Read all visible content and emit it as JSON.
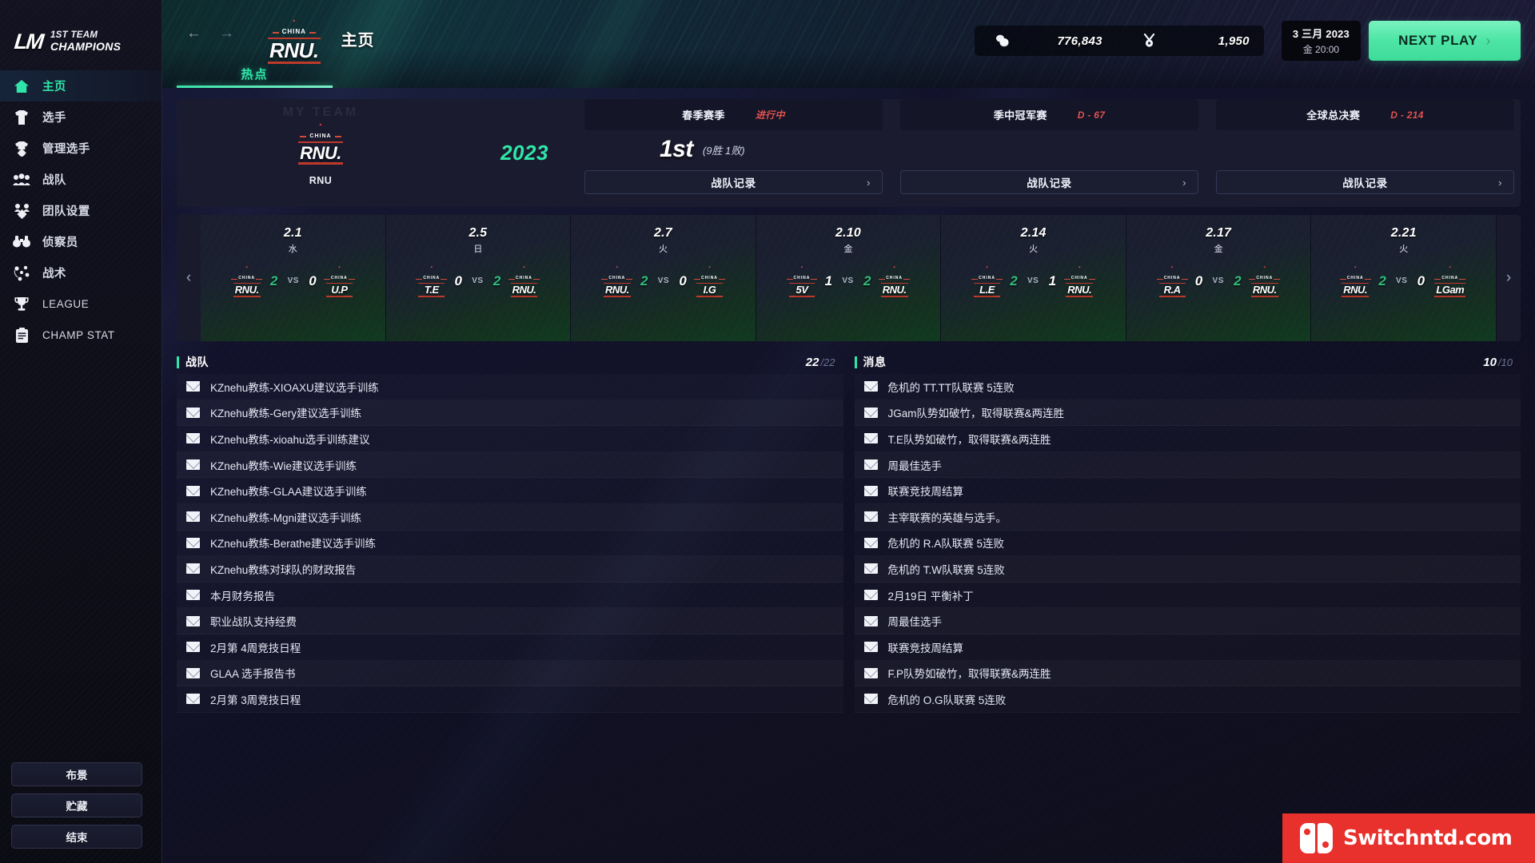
{
  "brand": {
    "mark": "LM",
    "line1": "1ST TEAM",
    "line2": "CHAMPIONS"
  },
  "sidebar": {
    "items": [
      {
        "label": "主页",
        "icon": "home-icon",
        "active": true
      },
      {
        "label": "选手",
        "icon": "jersey-icon",
        "active": false
      },
      {
        "label": "管理选手",
        "icon": "jersey-gear-icon",
        "active": false
      },
      {
        "label": "战队",
        "icon": "people-icon",
        "active": false
      },
      {
        "label": "团队设置",
        "icon": "people-gear-icon",
        "active": false
      },
      {
        "label": "侦察员",
        "icon": "binoculars-icon",
        "active": false
      },
      {
        "label": "战术",
        "icon": "tactics-icon",
        "active": false
      },
      {
        "label": "LEAGUE",
        "icon": "trophy-icon",
        "active": false
      },
      {
        "label": "CHAMP STAT",
        "icon": "clipboard-icon",
        "active": false
      }
    ],
    "buttons": [
      {
        "label": "布景"
      },
      {
        "label": "贮藏"
      },
      {
        "label": "结束"
      }
    ]
  },
  "header": {
    "back_icon": "arrow-left-icon",
    "forward_icon": "arrow-right-icon",
    "team_logo": {
      "ribbon": "CHINA",
      "name": "RNU."
    },
    "page_title": "主页",
    "currency": {
      "coin_icon": "coin-stack-icon",
      "coin_value": "776,843",
      "token_icon": "medal-icon",
      "token_value": "1,950"
    },
    "date": {
      "line1": "3 三月 2023",
      "line2": "金 20:00"
    },
    "next_play": {
      "label": "NEXT PLAY",
      "chevron": "›"
    },
    "tabs": [
      {
        "label": "热点",
        "active": true
      }
    ]
  },
  "summary": {
    "my_team_watermark": "MY TEAM",
    "team_logo": {
      "ribbon": "CHINA",
      "name": "RNU."
    },
    "team_name": "RNU",
    "year": "2023",
    "phases": [
      {
        "name": "春季赛季",
        "badge": "进行中"
      },
      {
        "name": "季中冠军赛",
        "badge": "D - 67"
      },
      {
        "name": "全球总决赛",
        "badge": "D - 214"
      }
    ],
    "rank": "1st",
    "record": "(9胜 1败)",
    "record_buttons": [
      {
        "label": "战队记录",
        "chevron": "›"
      },
      {
        "label": "战队记录",
        "chevron": "›"
      },
      {
        "label": "战队记录",
        "chevron": "›"
      }
    ]
  },
  "matches": {
    "prev_icon": "chevron-left-icon",
    "next_icon": "chevron-right-icon",
    "vs_label": "VS",
    "items": [
      {
        "date": "2.1",
        "day": "水",
        "home": "RNU.",
        "home_score": "2",
        "away": "U.P",
        "away_score": "0",
        "winner": "home"
      },
      {
        "date": "2.5",
        "day": "日",
        "home": "T.E",
        "home_score": "0",
        "away": "RNU.",
        "away_score": "2",
        "winner": "away"
      },
      {
        "date": "2.7",
        "day": "火",
        "home": "RNU.",
        "home_score": "2",
        "away": "I.G",
        "away_score": "0",
        "winner": "home"
      },
      {
        "date": "2.10",
        "day": "金",
        "home": "5V",
        "home_score": "1",
        "away": "RNU.",
        "away_score": "2",
        "winner": "away"
      },
      {
        "date": "2.14",
        "day": "火",
        "home": "L.E",
        "home_score": "2",
        "away": "RNU.",
        "away_score": "1",
        "winner": "home"
      },
      {
        "date": "2.17",
        "day": "金",
        "home": "R.A",
        "home_score": "0",
        "away": "RNU.",
        "away_score": "2",
        "winner": "away"
      },
      {
        "date": "2.21",
        "day": "火",
        "home": "RNU.",
        "home_score": "2",
        "away": "LGam",
        "away_score": "0",
        "winner": "home"
      }
    ]
  },
  "panels": [
    {
      "title": "战队",
      "count_current": "22",
      "count_total": "/22",
      "rows": [
        "KZnehu教练-XIOAXU建议选手训练",
        "KZnehu教练-Gery建议选手训练",
        "KZnehu教练-xioahu选手训练建议",
        "KZnehu教练-Wie建议选手训练",
        "KZnehu教练-GLAA建议选手训练",
        "KZnehu教练-Mgni建议选手训练",
        "KZnehu教练-Berathe建议选手训练",
        "KZnehu教练对球队的财政报告",
        "本月财务报告",
        "职业战队支持经费",
        "2月第 4周竞技日程",
        "GLAA 选手报告书",
        "2月第 3周竞技日程"
      ]
    },
    {
      "title": "消息",
      "count_current": "10",
      "count_total": "/10",
      "rows": [
        "危机的 TT.TT队联赛 5连败",
        "JGam队势如破竹，取得联赛&两连胜",
        "T.E队势如破竹，取得联赛&两连胜",
        "周最佳选手",
        "联赛竞技周结算",
        "主宰联赛的英雄与选手。",
        "危机的 R.A队联赛 5连败",
        "危机的 T.W队联赛 5连败",
        "2月19日 平衡补丁",
        "周最佳选手",
        "联赛竞技周结算",
        "F.P队势如破竹，取得联赛&两连胜",
        "危机的 O.G队联赛 5连败"
      ]
    }
  ],
  "watermark": {
    "text": "Switchntd.com",
    "icon": "nintendo-switch-icon"
  },
  "colors": {
    "accent": "#2fe6a8",
    "danger": "#e0524f",
    "panel": "#1a1b2e",
    "watermark": "#e8302c"
  }
}
